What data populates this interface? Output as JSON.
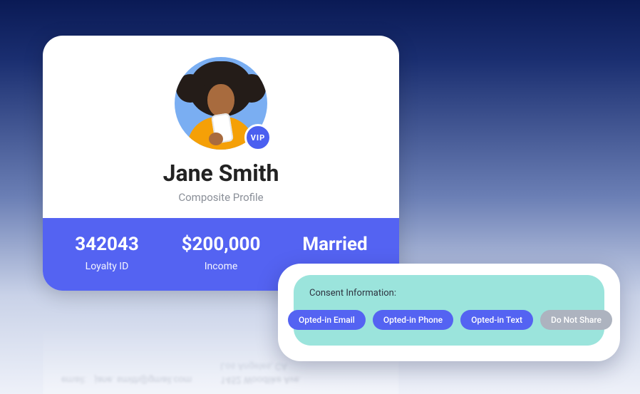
{
  "profile": {
    "name": "Jane Smith",
    "subtitle": "Composite Profile",
    "vip_label": "VIP",
    "avatar_icon": "person-with-phone"
  },
  "stats": [
    {
      "value": "342043",
      "label": "Loyalty ID"
    },
    {
      "value": "$200,000",
      "label": "Income"
    },
    {
      "value": "Married",
      "label": ""
    }
  ],
  "reflection": {
    "email_label": "email:",
    "email_value": "jane. smith@gmail.com",
    "addr_value": "1452 Woodlike Ave.",
    "city_value": "Los Angeles, CA"
  },
  "consent": {
    "title": "Consent Information:",
    "chips": [
      {
        "text": "Opted-in Email",
        "variant": "blue"
      },
      {
        "text": "Opted-in Phone",
        "variant": "blue"
      },
      {
        "text": "Opted-in Text",
        "variant": "blue"
      },
      {
        "text": "Do Not Share",
        "variant": "grey"
      }
    ]
  },
  "colors": {
    "accent": "#5463f2",
    "teal": "#9be4dc",
    "grey_chip": "#adb3bf"
  }
}
